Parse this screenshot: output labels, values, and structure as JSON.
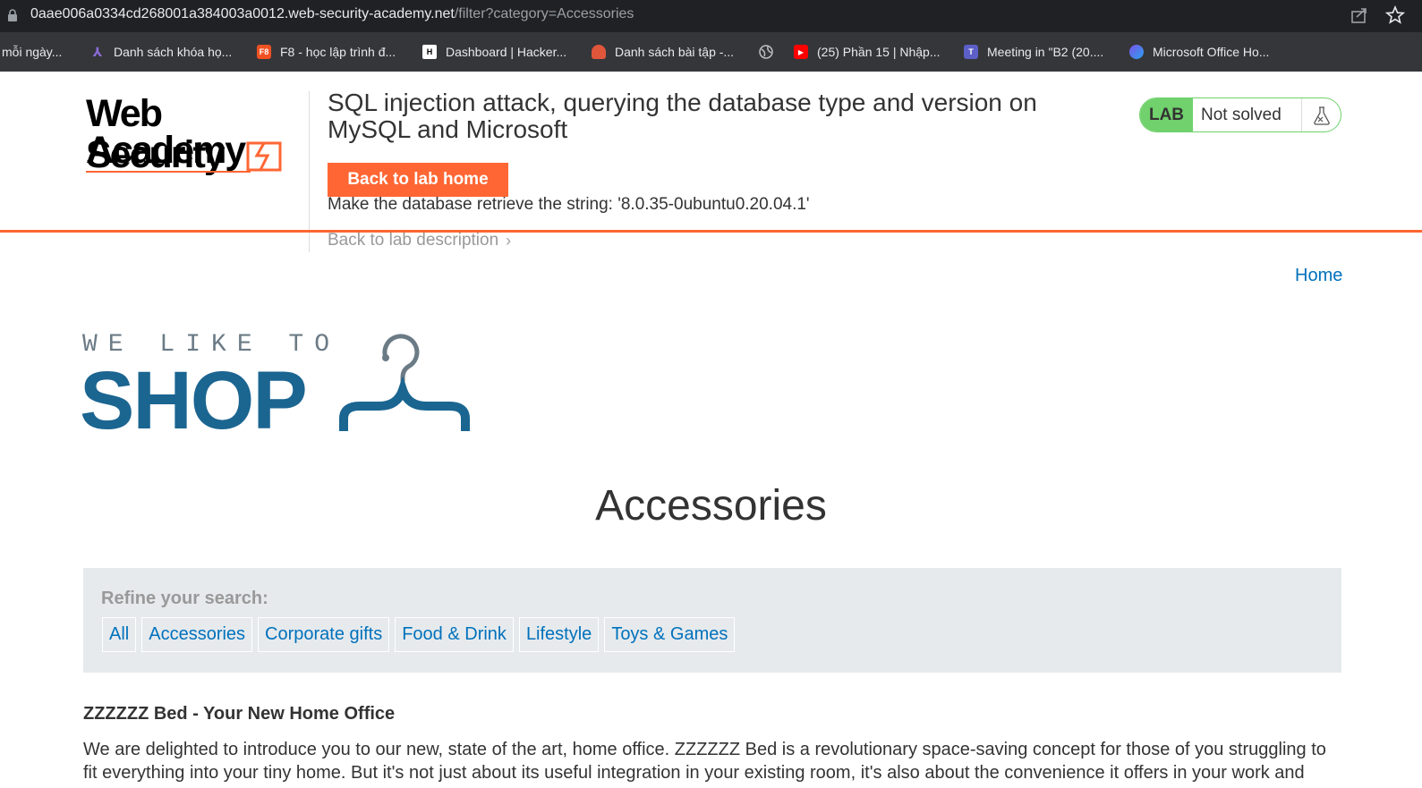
{
  "browser": {
    "url_host": "0aae006a0334cd268001a384003a0012.web-security-academy.net",
    "url_path": "/filter?category=Accessories",
    "bookmarks": [
      {
        "label": "mỗi ngày...",
        "icon": "none"
      },
      {
        "label": "Danh sách khóa họ...",
        "icon": "academy-icon"
      },
      {
        "label": "F8 - học lập trình đ...",
        "icon": "f8-icon"
      },
      {
        "label": "Dashboard | Hacker...",
        "icon": "hackerrank-icon"
      },
      {
        "label": "Danh sách bài tập -...",
        "icon": "person-icon"
      },
      {
        "label": "",
        "icon": "globe-icon"
      },
      {
        "label": "(25) Phần 15 | Nhập...",
        "icon": "youtube-icon"
      },
      {
        "label": "Meeting in \"B2 (20....",
        "icon": "teams-icon"
      },
      {
        "label": "Microsoft Office Ho...",
        "icon": "office-icon"
      }
    ]
  },
  "lab": {
    "logo_line1": "Web Security",
    "logo_line2": "Academy",
    "title": "SQL injection attack, querying the database type and version on MySQL and Microsoft",
    "back_home": "Back to lab home",
    "instruction": "Make the database retrieve the string: '8.0.35-0ubuntu0.20.04.1'",
    "back_description": "Back to lab description",
    "status_badge": "LAB",
    "status_text": "Not solved",
    "accent_color": "#ff6633",
    "status_color": "#70d16d"
  },
  "nav": {
    "home": "Home"
  },
  "shop": {
    "tagline": "WE LIKE TO",
    "name": "SHOP",
    "brand_color": "#1b6591"
  },
  "category": {
    "title": "Accessories",
    "refine_label": "Refine your search:",
    "filters": [
      "All",
      "Accessories",
      "Corporate gifts",
      "Food & Drink",
      "Lifestyle",
      "Toys & Games"
    ]
  },
  "article": {
    "title": "ZZZZZZ Bed - Your New Home Office",
    "body": "We are delighted to introduce you to our new, state of the art, home office. ZZZZZZ Bed is a revolutionary space-saving concept for those of you struggling to fit everything into your tiny home. But it's not just about its useful integration in your existing room, it's also about the convenience it offers in your work and leisure"
  }
}
